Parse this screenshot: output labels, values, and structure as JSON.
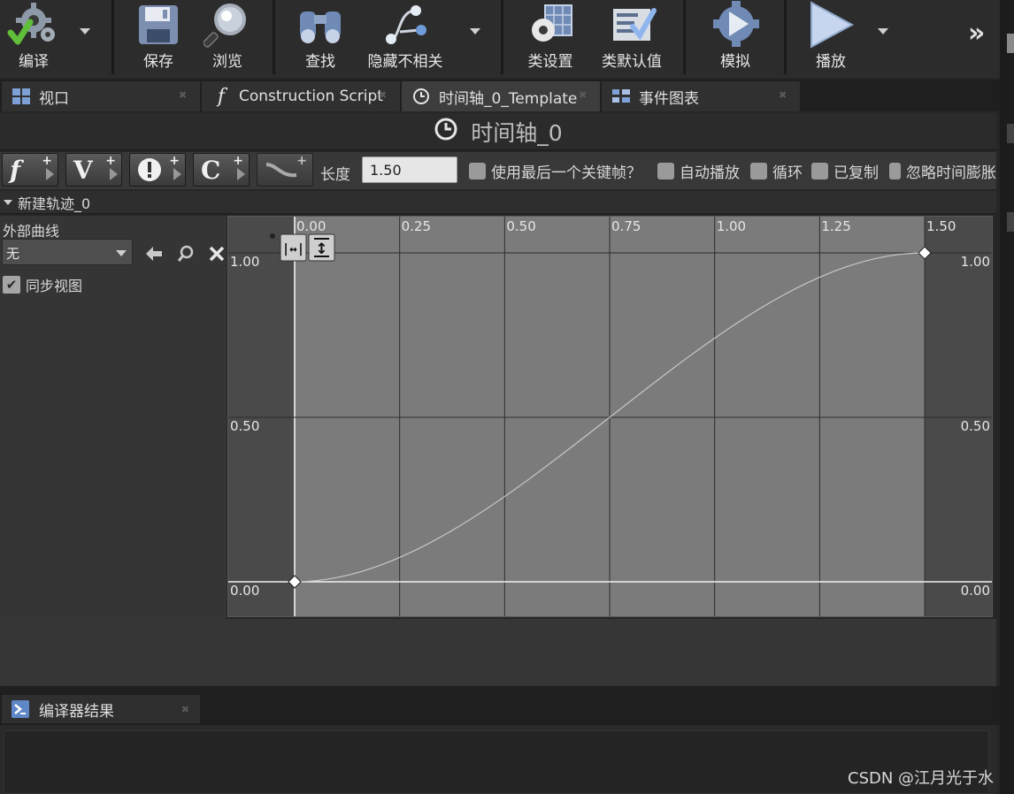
{
  "toolbar": {
    "compile": "编译",
    "save": "保存",
    "browse": "浏览",
    "find": "查找",
    "hide_unrelated": "隐藏不相关",
    "class_settings": "类设置",
    "class_defaults": "类默认值",
    "simulate": "模拟",
    "play": "播放",
    "more_icon": "double-chevron-right-icon"
  },
  "tabs": [
    {
      "label": "视口",
      "icon": "viewport-icon"
    },
    {
      "label": "Construction Script",
      "icon": "function-icon"
    },
    {
      "label": "时间轴_0_Template",
      "icon": "clock-icon"
    },
    {
      "label": "事件图表",
      "icon": "event-graph-icon"
    }
  ],
  "timeline": {
    "title": "时间轴_0",
    "length_label": "长度",
    "length_value": "1.50",
    "options": [
      {
        "label": "使用最后一个关键帧？",
        "checked": false
      },
      {
        "label": "自动播放",
        "checked": false
      },
      {
        "label": "循环",
        "checked": false
      },
      {
        "label": "已复制",
        "checked": false
      },
      {
        "label": "忽略时间膨胀",
        "checked": false
      }
    ],
    "track_buttons": [
      {
        "glyph": "f",
        "name": "add-float-track"
      },
      {
        "glyph": "V",
        "name": "add-vector-track"
      },
      {
        "glyph": "!",
        "name": "add-event-track"
      },
      {
        "glyph": "C",
        "name": "add-color-track"
      },
      {
        "glyph": "~",
        "name": "add-external-curve"
      }
    ]
  },
  "track": {
    "name": "新建轨迹_0",
    "external_curve_label": "外部曲线",
    "external_curve_value": "无",
    "sync_view_label": "同步视图",
    "sync_view_checked": true
  },
  "curve": {
    "x_ticks": [
      "0.00",
      "0.25",
      "0.50",
      "0.75",
      "1.00",
      "1.25",
      "1.50"
    ],
    "y_ticks_left": [
      "1.00",
      "0.50",
      "0.00"
    ],
    "y_ticks_right": [
      "1.00",
      "0.50",
      "0.00"
    ],
    "keys": [
      {
        "time": 0.0,
        "value": 0.0
      },
      {
        "time": 1.5,
        "value": 1.0
      }
    ],
    "length": 1.5
  },
  "bottom": {
    "tab_label": "编译器结果"
  },
  "watermark": "CSDN @江月光于水"
}
